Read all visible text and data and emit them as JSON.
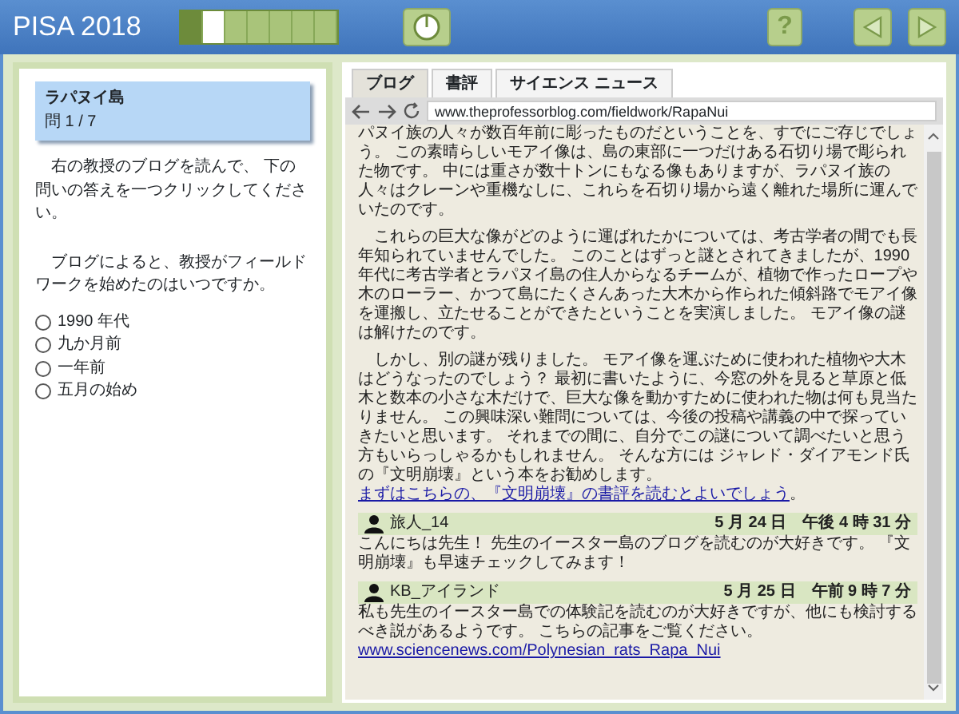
{
  "header": {
    "title": "PISA 2018",
    "progress": [
      {
        "kind": "done"
      },
      {
        "kind": "current"
      },
      {
        "kind": "todo"
      },
      {
        "kind": "todo"
      },
      {
        "kind": "todo"
      },
      {
        "kind": "todo"
      },
      {
        "kind": "todo"
      }
    ],
    "help": "?"
  },
  "question": {
    "title": "ラパヌイ島",
    "number": "問 1 / 7",
    "instruction": "右の教授のブログを読んで、 下の問いの答えを一つクリックしてください。",
    "prompt": "ブログによると、教授がフィールドワークを始めたのはいつですか。",
    "options": [
      {
        "label": "1990 年代",
        "selected": false
      },
      {
        "label": "九か月前",
        "selected": false
      },
      {
        "label": "一年前",
        "selected": false
      },
      {
        "label": "五月の始め",
        "selected": false
      }
    ]
  },
  "browser": {
    "tabs": [
      {
        "label": "ブログ",
        "selected": true
      },
      {
        "label": "書評",
        "selected": false
      },
      {
        "label": "サイエンス ニュース",
        "selected": false
      }
    ],
    "url": "www.theprofessorblog.com/fieldwork/RapaNui",
    "paragraphs": [
      {
        "text": "パヌイ族の人々が数百年前に彫ったものだということを、すでにご存じでしょう。 この素晴らしいモアイ像は、島の東部に一つだけある石切り場で彫られた物です。 中には重さが数十トンにもなる像もありますが、ラパヌイ族の人々はクレーンや重機なしに、これらを石切り場から遠く離れた場所に運んでいたのです。"
      },
      {
        "text": "　これらの巨大な像がどのように運ばれたかについては、考古学者の間でも長年知られていませんでした。 このことはずっと謎とされてきましたが、1990 年代に考古学者とラパヌイ島の住人からなるチームが、植物で作ったロープや木のローラー、かつて島にたくさんあった大木から作られた傾斜路でモアイ像を運搬し、立たせることができたということを実演しました。 モアイ像の謎は解けたのです。"
      },
      {
        "text": "　しかし、別の謎が残りました。 モアイ像を運ぶために使われた植物や大木はどうなったのでしょう？ 最初に書いたように、今窓の外を見ると草原と低木と数本の小さな木だけで、巨大な像を動かすために使われた物は何も見当たりません。 この興味深い難問については、今後の投稿や講義の中で探っていきたいと思います。 それまでの間に、自分でこの謎について調べたいと思う方もいらっしゃるかもしれません。 そんな方には ジャレド・ダイアモンド氏の『文明崩壊』という本をお勧めします。 ",
        "link": "まずはこちらの、『文明崩壊』の書評を読むとよいでしょう",
        "after": "。"
      }
    ],
    "comments": [
      {
        "user": "旅人_14",
        "date": "5 月 24 日　午後 4 時 31 分",
        "text": "こんにちは先生！ 先生のイースター島のブログを読むのが大好きです。 『文明崩壊』も早速チェックしてみます！"
      },
      {
        "user": "KB_アイランド",
        "date": "5 月 25 日　午前 9 時 7 分",
        "text": "私も先生のイースター島での体験記を読むのが大好きですが、他にも検討するべき説があるようです。 こちらの記事をご覧ください。",
        "link": "www.sciencenews.com/Polynesian_rats_Rapa_Nui"
      }
    ]
  }
}
